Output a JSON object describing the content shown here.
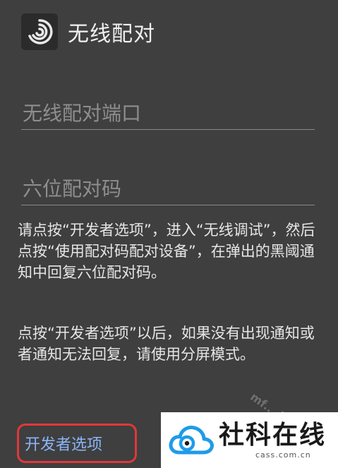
{
  "header": {
    "title": "无线配对",
    "icon": "spiral-app-icon"
  },
  "fields": {
    "pairing_code_placeholder": "无线配对端口",
    "pin_placeholder": "六位配对码"
  },
  "instructions": {
    "paragraph_1": "请点按“开发者选项”，进入“无线调试”，然后点按“使用配对码配对设备”，在弹出的黑阈通知中回复六位配对码。",
    "paragraph_2": "点按“开发者选项”以后，如果没有出现通知或者通知无法回复，请使用分屏模式。"
  },
  "actions": {
    "dev_options_label": "开发者选项"
  },
  "watermark": {
    "text": "mf... 魔"
  },
  "logo": {
    "text": "社科在线",
    "subtext": "cass.com.cn"
  },
  "colors": {
    "background": "#3f3f3f",
    "link": "#8ab4f8",
    "highlight_border": "#e0383a",
    "logo_blue": "#1e9be9"
  }
}
